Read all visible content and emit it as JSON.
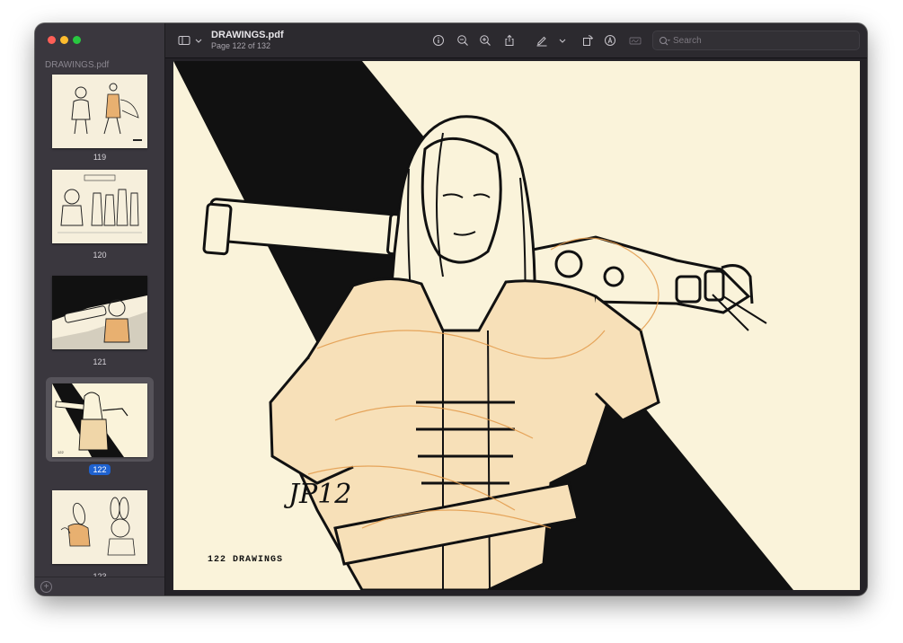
{
  "sidebar": {
    "title": "DRAWINGS.pdf",
    "thumbnails": [
      {
        "label": "119",
        "selected": false
      },
      {
        "label": "120",
        "selected": false
      },
      {
        "label": "121",
        "selected": false
      },
      {
        "label": "122",
        "selected": true
      },
      {
        "label": "123",
        "selected": false
      }
    ]
  },
  "toolbar": {
    "doc_title": "DRAWINGS.pdf",
    "page_info": "Page 122 of 132",
    "search_placeholder": "Search",
    "icons": [
      "sidebar-toggle-icon",
      "chevron-down-icon",
      "info-icon",
      "zoom-out-icon",
      "zoom-in-icon",
      "share-icon",
      "highlight-pen-icon",
      "chevron-down-icon",
      "rotate-icon",
      "markup-icon",
      "signature-icon",
      "search-icon"
    ]
  },
  "page": {
    "caption": "122   DRAWINGS",
    "signature": "JP12"
  },
  "colors": {
    "accent": "#1e62d0",
    "paper": "#faf3da",
    "ink": "#111111",
    "pencil": "#e39a4a"
  }
}
